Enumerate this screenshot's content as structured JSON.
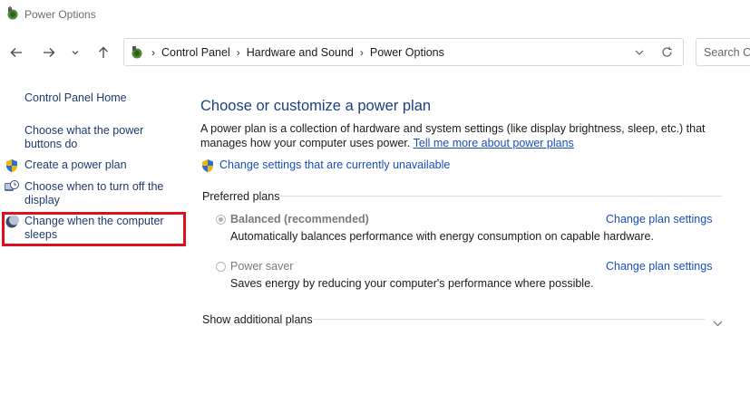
{
  "window": {
    "title": "Power Options",
    "icon": "power-options-icon"
  },
  "nav": {
    "back": "back-arrow-icon",
    "forward": "forward-arrow-icon",
    "recent": "chevron-down-icon",
    "up": "up-arrow-icon",
    "breadcrumbs": [
      "Control Panel",
      "Hardware and Sound",
      "Power Options"
    ],
    "search_placeholder": "Search Co"
  },
  "sidebar": {
    "home": "Control Panel Home",
    "items": [
      {
        "label_line1": "Choose what the power",
        "label_line2": "buttons do",
        "icon": ""
      },
      {
        "label_line1": "Create a power plan",
        "label_line2": "",
        "icon": "uac-shield-icon"
      },
      {
        "label_line1": "Choose when to turn off the",
        "label_line2": "display",
        "icon": "display-clock-icon"
      },
      {
        "label_line1": "Change when the computer",
        "label_line2": "sleeps",
        "icon": "moon-sleep-icon",
        "highlighted": true
      }
    ],
    "highlight_color": "#d8131f"
  },
  "main": {
    "heading": "Choose or customize a power plan",
    "description": "A power plan is a collection of hardware and system settings (like display brightness, sleep, etc.) that manages how your computer uses power.",
    "learn_more": "Tell me more about power plans",
    "change_unavailable": "Change settings that are currently unavailable",
    "preferred_label": "Preferred plans",
    "plans": [
      {
        "name": "Balanced (recommended)",
        "selected": true,
        "description": "Automatically balances performance with energy consumption on capable hardware.",
        "action": "Change plan settings"
      },
      {
        "name": "Power saver",
        "selected": false,
        "description": "Saves energy by reducing your computer's performance where possible.",
        "action": "Change plan settings"
      }
    ],
    "additional_plans": "Show additional plans"
  },
  "colors": {
    "heading": "#1c3f80",
    "link": "#1a4ebc",
    "sidebar_link": "#1e3a6e"
  }
}
